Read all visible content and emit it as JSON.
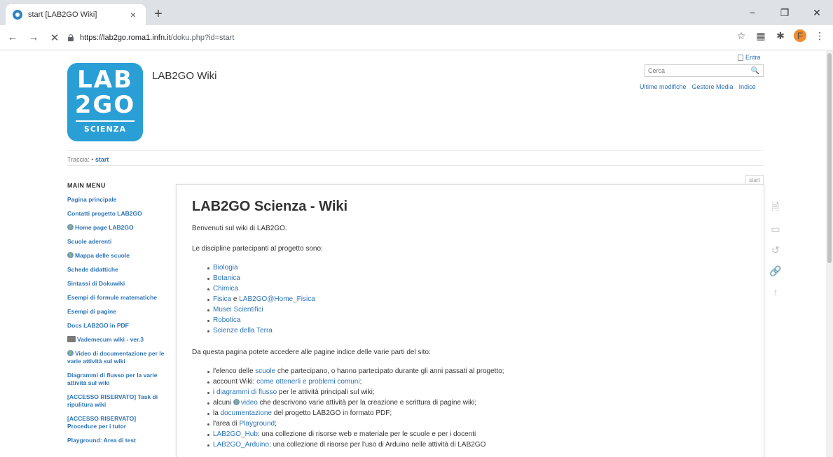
{
  "browser": {
    "tab_title": "start [LAB2GO Wiki]",
    "tab_close": "×",
    "new_tab": "+",
    "url_host": "https://lab2go.roma1.infn.it",
    "url_path": "/doku.php?id=start",
    "back_icon": "←",
    "forward_icon": "→",
    "stop_icon": "✕",
    "star_icon": "☆",
    "grid_icon": "▦",
    "ext_icon": "✱",
    "avatar_letter": "F",
    "menu_icon": "⋮",
    "minimize": "−",
    "maximize": "❐",
    "close": "✕"
  },
  "site": {
    "logo_line1": "LAB",
    "logo_line2": "2GO",
    "logo_line3": "SCIENZA",
    "title": "LAB2GO Wiki",
    "login": "Entra",
    "search_placeholder": "Cerca",
    "search_icon": "🔍",
    "tools": [
      "Ultime modifiche",
      "Gestore Media",
      "Indice"
    ],
    "breadcrumb_label": "Traccia:",
    "breadcrumb_sep": "•",
    "breadcrumb_page": "start",
    "page_tab": "start"
  },
  "sidebar": {
    "title": "MAIN MENU",
    "items": [
      {
        "label": "Pagina principale"
      },
      {
        "label": "Contatti progetto LAB2GO"
      },
      {
        "label": "Home page LAB2GO"
      },
      {
        "label": "Scuole aderenti"
      },
      {
        "label": "Mappa delle scuole"
      },
      {
        "label": "Schede didattiche"
      },
      {
        "label": "Sintassi di Dokuwiki"
      },
      {
        "label": "Esempi di formule matematiche"
      },
      {
        "label": "Esempi di pagine"
      },
      {
        "label": "Docs LAB2GO in PDF"
      },
      {
        "label": "Vademecum wiki - ver.3"
      },
      {
        "label": "Video di documentazione per le varie attività sul wiki"
      },
      {
        "label": "Diagrammi di flusso per la varie attività sul wiki"
      },
      {
        "label": "[ACCESSO RISERVATO] Task di ripulitura wiki"
      },
      {
        "label": "[ACCESSO RISERVATO] Procedure per i tutor"
      },
      {
        "label": "Playground: Area di test"
      }
    ]
  },
  "content": {
    "heading": "LAB2GO Scienza - Wiki",
    "intro": "Benvenuti sul wiki di LAB2GO.",
    "disciplines_intro": "Le discipline partecipanti al progetto sono:",
    "disciplines": {
      "d1": "Biologia",
      "d2": "Botanica",
      "d3": "Chimica",
      "d4a": "Fisica",
      "d4b": " e ",
      "d4c": "LAB2GO@Home_Fisica",
      "d5": "Musei Scientifici",
      "d6": "Robotica",
      "d7": "Scienze della Terra"
    },
    "access_intro": "Da questa pagina potete accedere alle pagine indice delle varie parti del sito:",
    "items": {
      "i1a": "l'elenco delle ",
      "i1b": "scuole",
      "i1c": " che partecipano, o hanno partecipato durante gli anni passati al progetto;",
      "i2a": "account Wiki: ",
      "i2b": "come ottenerli",
      "i2c": " e ",
      "i2d": "problemi comuni",
      "i2e": ";",
      "i3a": "i ",
      "i3b": "diagrammi di flusso",
      "i3c": " per le attività principali sul wiki;",
      "i4a": "alcuni ",
      "i4b": "video",
      "i4c": " che descrivono varie attività per la creazione e scrittura di pagine wiki;",
      "i5a": "la ",
      "i5b": "documentazione",
      "i5c": " del progetto LAB2GO in formato PDF;",
      "i6a": "l'area di ",
      "i6b": "Playground",
      "i6c": ";",
      "i7a": "LAB2GO_Hub",
      "i7b": ": una collezione di risorse web e materiale per le scuole e per i docenti",
      "i8a": "LAB2GO_Arduino",
      "i8b": ": una collezione di risorse per l'uso di Arduino nelle attività di LAB2GO"
    }
  },
  "pagetools": {
    "t1": "🗎",
    "t2": "▭",
    "t3": "↺",
    "t4": "🔗",
    "t5": "↑"
  }
}
